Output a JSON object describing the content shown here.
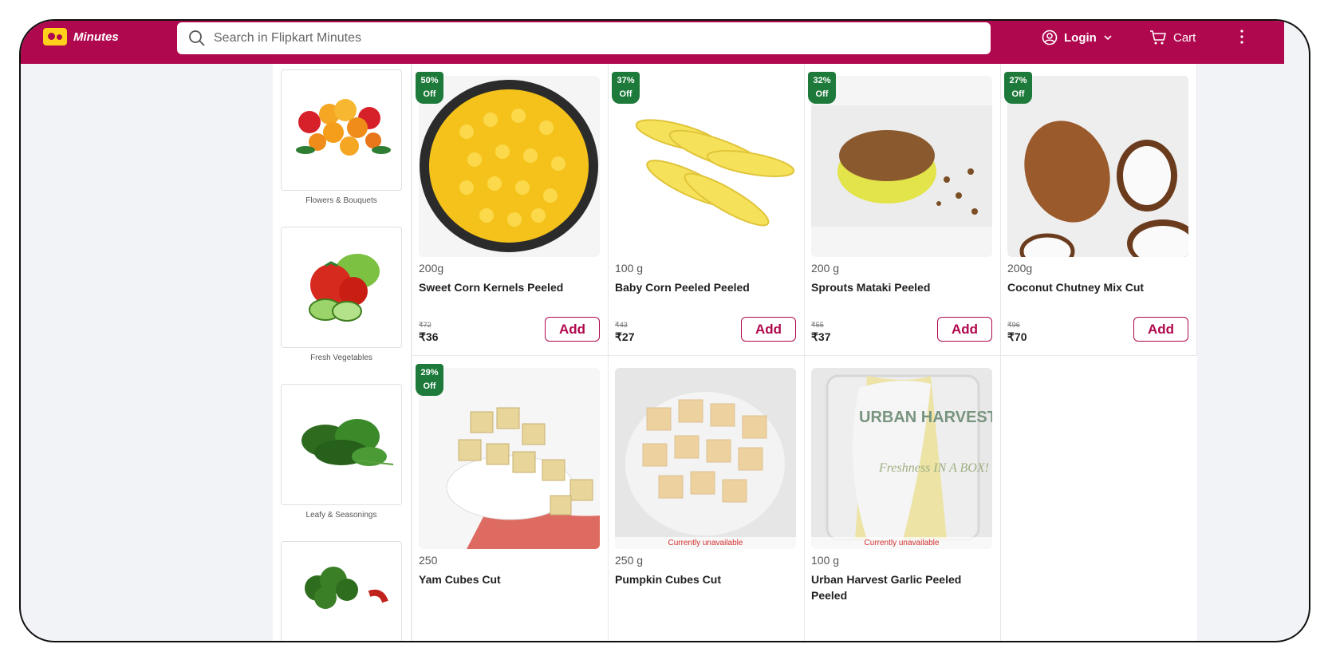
{
  "header": {
    "brand": "Minutes",
    "search_placeholder": "Search in Flipkart Minutes",
    "login_label": "Login",
    "cart_label": "Cart"
  },
  "categories": [
    {
      "label": "Flowers & Bouquets",
      "icon": "flowers-image"
    },
    {
      "label": "Fresh Vegetables",
      "icon": "vegetables-image"
    },
    {
      "label": "Leafy & Seasonings",
      "icon": "leafy-image"
    },
    {
      "label": "",
      "icon": "broccoli-image"
    }
  ],
  "products": [
    {
      "discount": "50%",
      "discount_suffix": "Off",
      "qty": "200g",
      "name": "Sweet Corn Kernels Peeled",
      "mrp": "₹72",
      "price": "₹36",
      "add": "Add",
      "image": "sweet-corn-image"
    },
    {
      "discount": "37%",
      "discount_suffix": "Off",
      "qty": "100 g",
      "name": "Baby Corn Peeled Peeled",
      "mrp": "₹43",
      "price": "₹27",
      "add": "Add",
      "image": "baby-corn-image"
    },
    {
      "discount": "32%",
      "discount_suffix": "Off",
      "qty": "200 g",
      "name": "Sprouts Mataki Peeled",
      "mrp": "₹55",
      "price": "₹37",
      "add": "Add",
      "image": "sprouts-image"
    },
    {
      "discount": "27%",
      "discount_suffix": "Off",
      "qty": "200g",
      "name": "Coconut Chutney Mix Cut",
      "mrp": "₹96",
      "price": "₹70",
      "add": "Add",
      "image": "coconut-image"
    },
    {
      "discount": "29%",
      "discount_suffix": "Off",
      "qty": "250",
      "name": "Yam Cubes Cut",
      "image": "yam-image"
    },
    {
      "qty": "250 g",
      "name": "Pumpkin Cubes Cut",
      "status": "Currently unavailable",
      "image": "pumpkin-image"
    },
    {
      "qty": "100 g",
      "name": "Urban Harvest Garlic Peeled Peeled",
      "status": "Currently unavailable",
      "image": "garlic-pack-image",
      "pack_brand": "URBAN HARVEST",
      "pack_tagline": "Freshness IN A BOX!"
    }
  ],
  "colors": {
    "brand": "#b0084e",
    "badge": "#1e7a3a",
    "unavailable": "#d32f2f"
  }
}
